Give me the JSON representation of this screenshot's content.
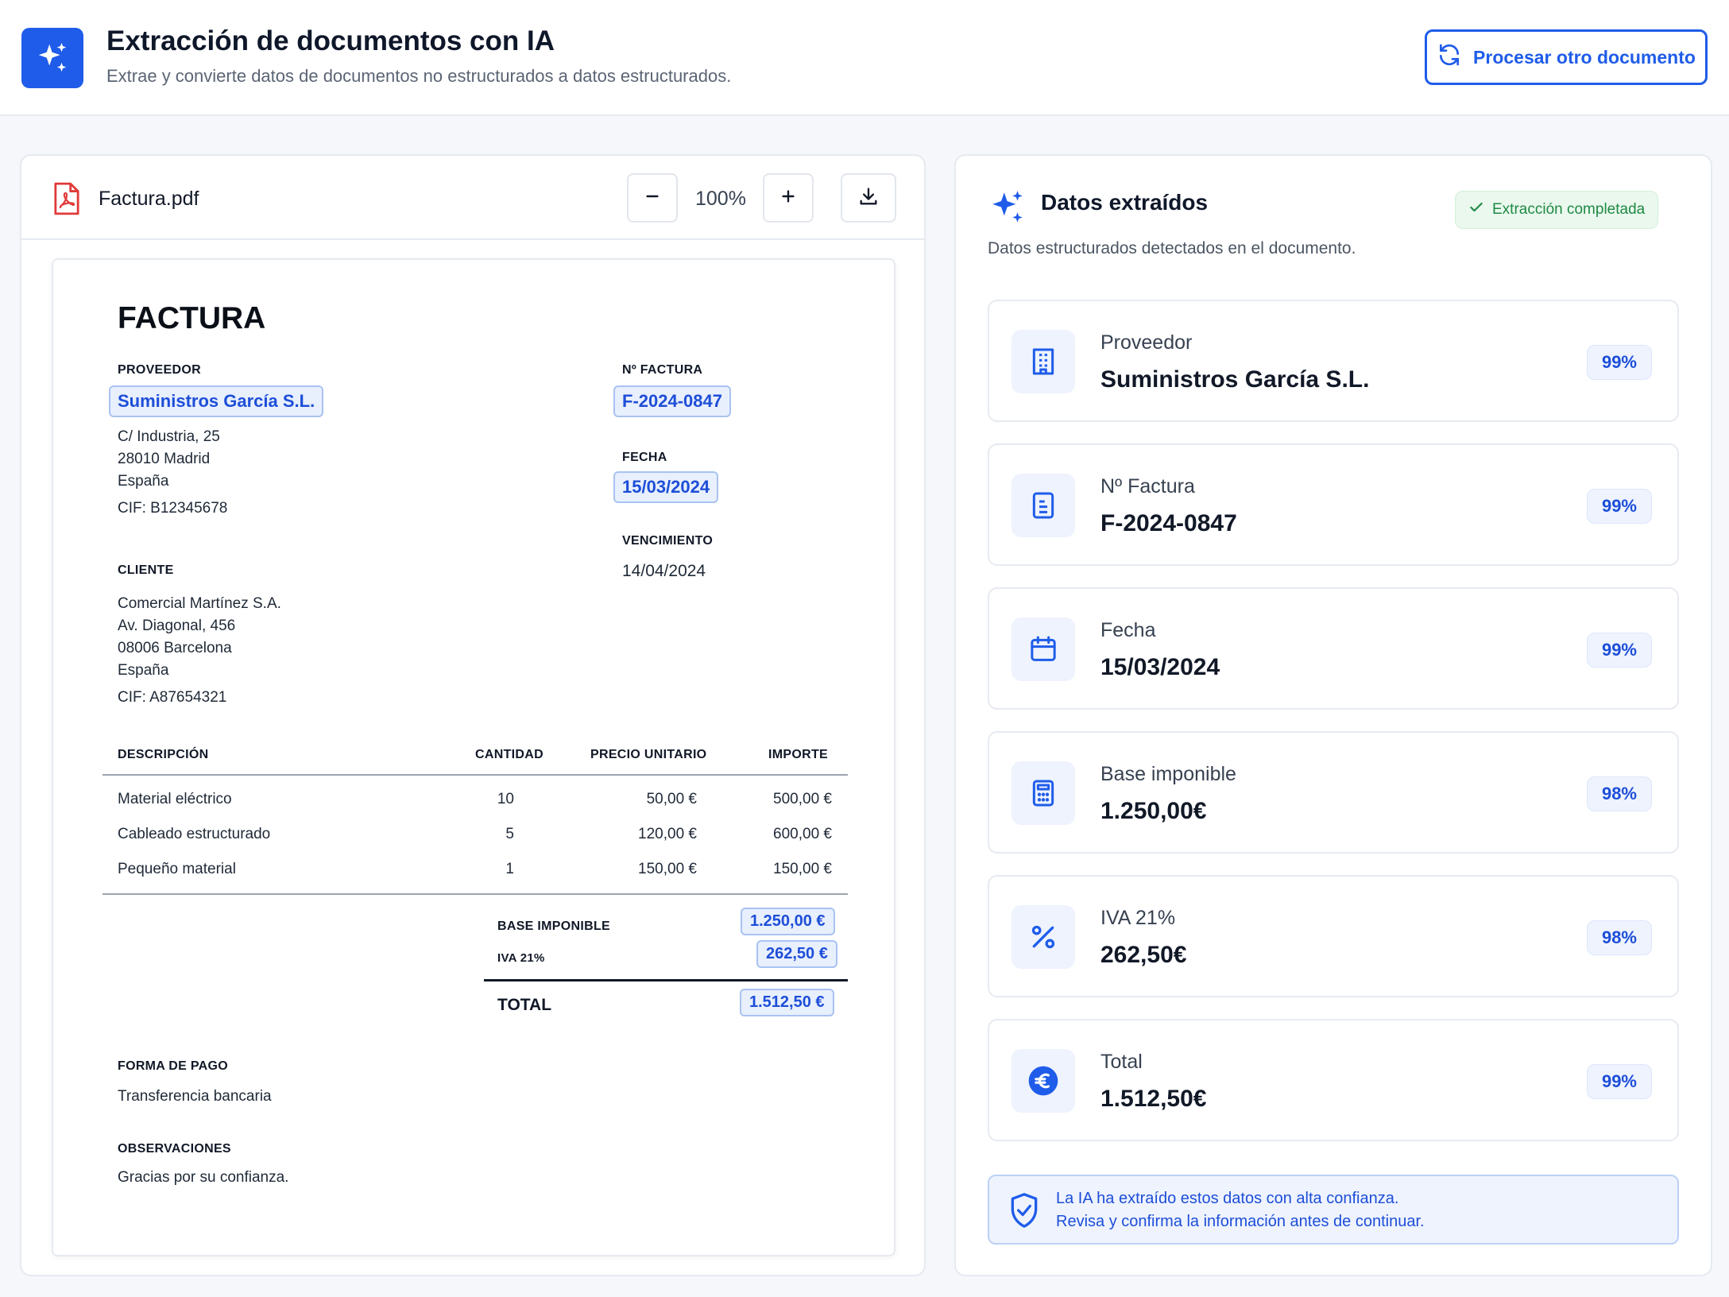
{
  "header": {
    "title": "Extracción de documentos con IA",
    "subtitle": "Extrae y convierte datos de documentos no estructurados a datos estructurados.",
    "process_button": "Procesar otro documento"
  },
  "viewer": {
    "file_name": "Factura.pdf",
    "zoom": "100%",
    "zoom_out_icon": "minus-icon",
    "zoom_in_icon": "plus-icon",
    "download_icon": "download-icon"
  },
  "document": {
    "title": "FACTURA",
    "provider_label": "PROVEEDOR",
    "provider_name": "Suministros García S.L.",
    "provider_address": [
      "C/ Industria, 25",
      "28010 Madrid",
      "España"
    ],
    "provider_cif": "CIF: B12345678",
    "invoice_no_label": "Nº FACTURA",
    "invoice_no": "F-2024-0847",
    "date_label": "FECHA",
    "date": "15/03/2024",
    "due_label": "VENCIMIENTO",
    "due_date": "14/04/2024",
    "client_label": "CLIENTE",
    "client_lines": [
      "Comercial Martínez S.A.",
      "Av. Diagonal, 456",
      "08006 Barcelona",
      "España"
    ],
    "client_cif": "CIF: A87654321",
    "table": {
      "headers": [
        "DESCRIPCIÓN",
        "CANTIDAD",
        "PRECIO UNITARIO",
        "IMPORTE"
      ],
      "rows": [
        [
          "Material eléctrico",
          "10",
          "50,00 €",
          "500,00 €"
        ],
        [
          "Cableado estructurado",
          "5",
          "120,00 €",
          "600,00 €"
        ],
        [
          "Pequeño material",
          "1",
          "150,00 €",
          "150,00 €"
        ]
      ]
    },
    "totals": {
      "base_label": "BASE IMPONIBLE",
      "base_value": "1.250,00 €",
      "iva_label": "IVA 21%",
      "iva_value": "262,50 €",
      "total_label": "TOTAL",
      "total_value": "1.512,50 €"
    },
    "payment_label": "FORMA DE PAGO",
    "payment_value": "Transferencia bancaria",
    "notes_label": "OBSERVACIONES",
    "notes_value": "Gracias por su confianza."
  },
  "extracted": {
    "title": "Datos extraídos",
    "status": "Extracción completada",
    "subtitle": "Datos estructurados detectados en el documento.",
    "fields": [
      {
        "icon": "building-icon",
        "label": "Proveedor",
        "value": "Suministros García S.L.",
        "confidence": "99%"
      },
      {
        "icon": "document-icon",
        "label": "Nº Factura",
        "value": "F-2024-0847",
        "confidence": "99%"
      },
      {
        "icon": "calendar-icon",
        "label": "Fecha",
        "value": "15/03/2024",
        "confidence": "99%"
      },
      {
        "icon": "calculator-icon",
        "label": "Base imponible",
        "value": "1.250,00€",
        "confidence": "98%"
      },
      {
        "icon": "percent-icon",
        "label": "IVA 21%",
        "value": "262,50€",
        "confidence": "98%"
      },
      {
        "icon": "euro-icon",
        "label": "Total",
        "value": "1.512,50€",
        "confidence": "99%"
      }
    ],
    "notice_line1": "La IA ha extraído estos datos con alta confianza.",
    "notice_line2": "Revisa y confirma la información antes de continuar."
  },
  "colors": {
    "accent": "#1f5ce9",
    "highlight_bg": "#e8effd",
    "success": "#1f8a44",
    "pdf_red": "#e03a3a"
  }
}
